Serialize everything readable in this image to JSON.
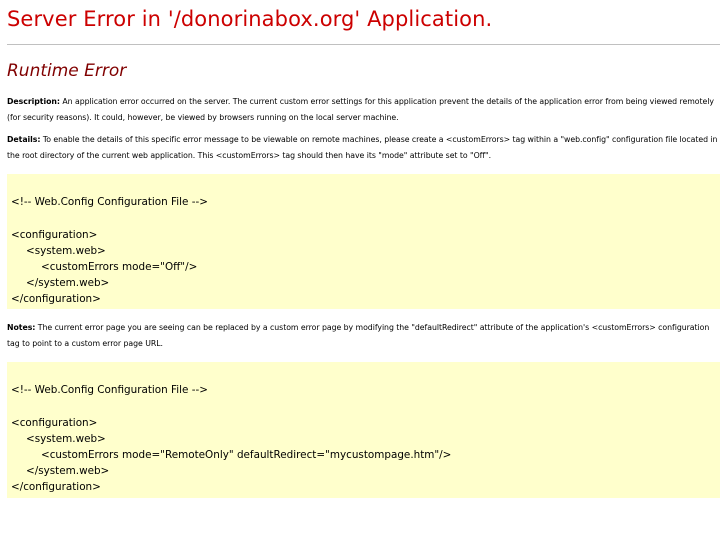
{
  "header": {
    "title": "Server Error in '/donorinabox.org' Application."
  },
  "error": {
    "subtitle": "Runtime Error",
    "description_label": "Description:",
    "description_text": " An application error occurred on the server. The current custom error settings for this application prevent the details of the application error from being viewed remotely (for security reasons). It could, however, be viewed by browsers running on the local server machine.",
    "details_label": "Details:",
    "details_text": " To enable the details of this specific error message to be viewable on remote machines, please create a <customErrors> tag within a \"web.config\" configuration file located in the root directory of the current web application. This <customErrors> tag should then have its \"mode\" attribute set to \"Off\".",
    "notes_label": "Notes:",
    "notes_text": " The current error page you are seeing can be replaced by a custom error page by modifying the \"defaultRedirect\" attribute of the application's <customErrors> configuration tag to point to a custom error page URL."
  },
  "code_block_1": {
    "lines": [
      "<!-- Web.Config Configuration File -->",
      "<configuration>",
      "<system.web>",
      "<customErrors mode=\"Off\"/>",
      "</system.web>",
      "</configuration>"
    ]
  },
  "code_block_2": {
    "lines": [
      "<!-- Web.Config Configuration File -->",
      "<configuration>",
      "<system.web>",
      "<customErrors mode=\"RemoteOnly\" defaultRedirect=\"mycustompage.htm\"/>",
      "</system.web>",
      "</configuration>"
    ]
  },
  "colors": {
    "title": "#cc0000",
    "subtitle": "#800000",
    "code_background": "#ffffcc"
  }
}
